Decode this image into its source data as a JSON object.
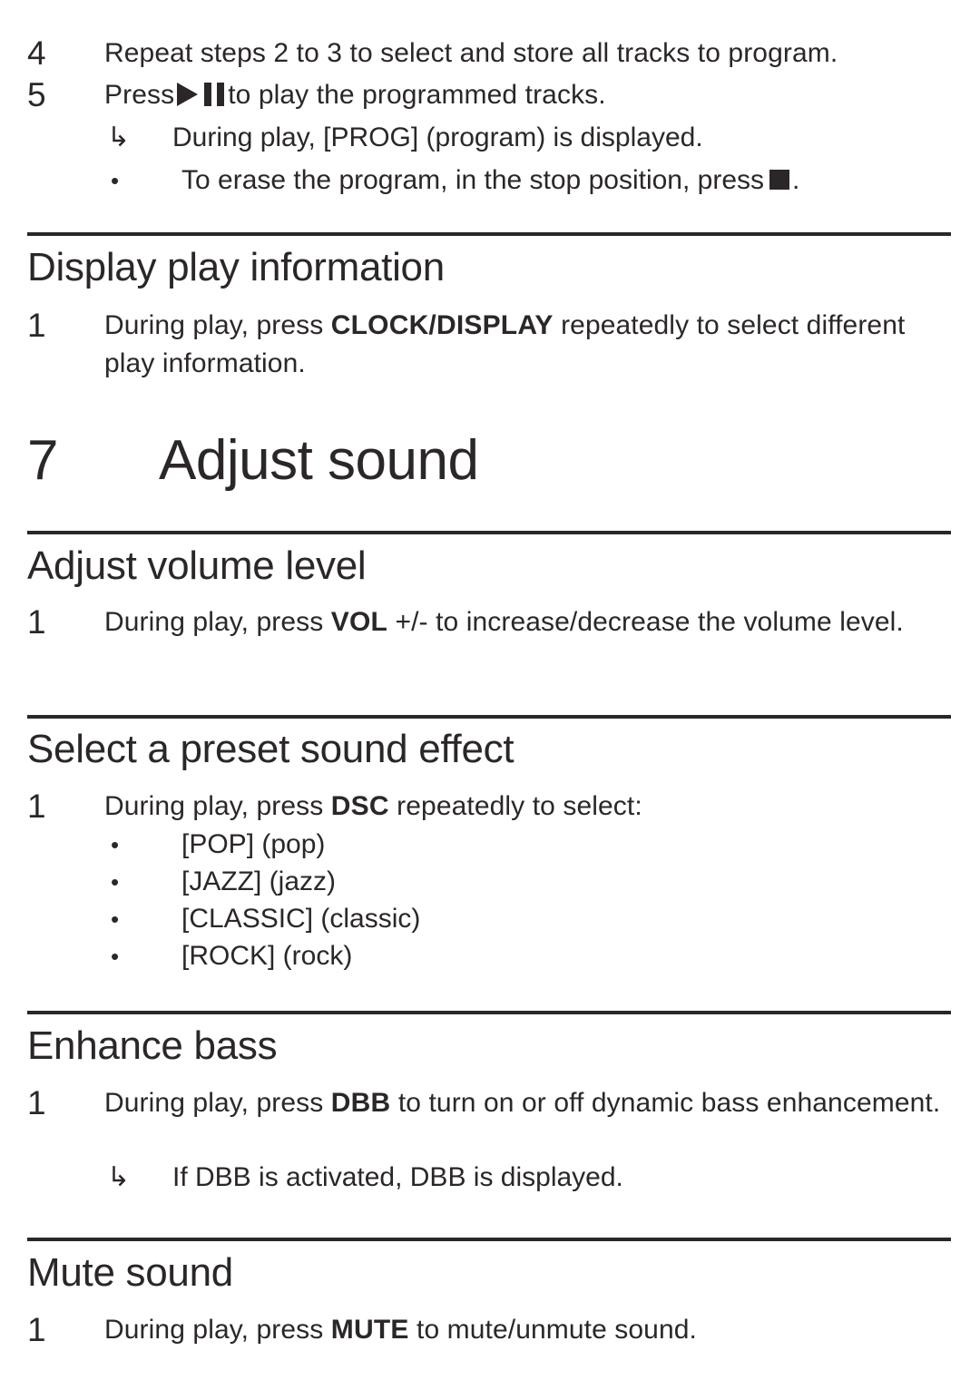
{
  "page": {
    "text_color": "#2b2728",
    "background": "#ffffff"
  },
  "top_steps": [
    {
      "number": "4",
      "text": "Repeat steps 2 to 3 to select and store all tracks to program."
    },
    {
      "number": "5",
      "text_before_icon": "Press",
      "icon": "play-pause-icon",
      "text_after_icon": "to play the programmed tracks."
    }
  ],
  "top_results": [
    {
      "marker": "↳",
      "marker_name": "result-arrow-icon",
      "text": "During play, [PROG] (program) is displayed."
    }
  ],
  "top_bullets": [
    {
      "marker": "•",
      "text_before_icon": "To erase the program, in the stop position, press",
      "icon": "stop-icon",
      "text_after_icon": "."
    }
  ],
  "sections": [
    {
      "id": "display-play-information",
      "title": "Display play information",
      "steps": [
        {
          "number": "1",
          "text_parts": [
            {
              "text": "During play, press ",
              "bold": false
            },
            {
              "text": "CLOCK/DISPLAY",
              "bold": true
            },
            {
              "text": " repeatedly to select different play information.",
              "bold": false
            }
          ]
        }
      ]
    },
    {
      "id": "adjust-volume-level",
      "title": "Adjust volume level",
      "steps": [
        {
          "number": "1",
          "text_parts": [
            {
              "text": "During play, press ",
              "bold": false
            },
            {
              "text": "VOL",
              "bold": true
            },
            {
              "text": " +/- to increase/decrease the volume level.",
              "bold": false
            }
          ]
        }
      ]
    },
    {
      "id": "select-a-preset-sound-effect",
      "title": "Select a preset sound effect",
      "steps": [
        {
          "number": "1",
          "text_parts": [
            {
              "text": "During play, press ",
              "bold": false
            },
            {
              "text": "DSC",
              "bold": true
            },
            {
              "text": " repeatedly to select:",
              "bold": false
            }
          ]
        }
      ],
      "bullets": [
        {
          "marker": "•",
          "text": "[POP] (pop)"
        },
        {
          "marker": "•",
          "text": "[JAZZ] (jazz)"
        },
        {
          "marker": "•",
          "text": "[CLASSIC] (classic)"
        },
        {
          "marker": "•",
          "text": "[ROCK] (rock)"
        }
      ]
    },
    {
      "id": "enhance-bass",
      "title": "Enhance bass",
      "steps": [
        {
          "number": "1",
          "text_parts": [
            {
              "text": "During play, press ",
              "bold": false
            },
            {
              "text": "DBB",
              "bold": true
            },
            {
              "text": " to turn on or off dynamic bass enhancement.",
              "bold": false
            }
          ]
        }
      ],
      "results": [
        {
          "marker": "↳",
          "text": "If DBB is activated, DBB is displayed."
        }
      ]
    },
    {
      "id": "mute-sound",
      "title": "Mute sound",
      "steps": [
        {
          "number": "1",
          "text_parts": [
            {
              "text": "During play, press ",
              "bold": false
            },
            {
              "text": "MUTE",
              "bold": true
            },
            {
              "text": " to mute/unmute sound.",
              "bold": false
            }
          ]
        }
      ]
    }
  ],
  "chapter": {
    "number": "7",
    "title": "Adjust sound"
  }
}
